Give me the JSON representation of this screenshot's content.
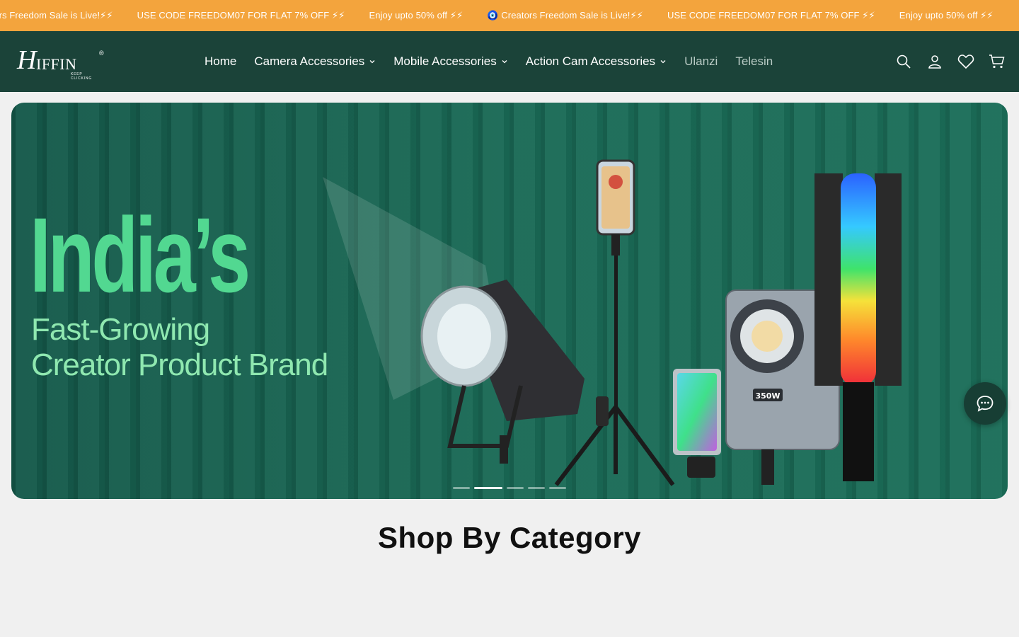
{
  "announcement": {
    "messages": [
      "Creators Freedom Sale is Live!⚡⚡",
      "USE CODE FREEDOM07 FOR FLAT 7% OFF ⚡⚡",
      "Enjoy upto 50% off ⚡⚡",
      "🧿 Creators Freedom Sale is Live!⚡⚡",
      "USE CODE FREEDOM07 FOR FLAT 7% OFF ⚡⚡",
      "Enjoy upto 50% off ⚡⚡"
    ]
  },
  "header": {
    "logo": {
      "mark": "H",
      "word": "IFFIN",
      "reg": "®",
      "tagline": "KEEP CLICKING"
    },
    "nav": [
      {
        "label": "Home",
        "dropdown": false
      },
      {
        "label": "Camera Accessories",
        "dropdown": true
      },
      {
        "label": "Mobile Accessories",
        "dropdown": true
      },
      {
        "label": "Action Cam Accessories",
        "dropdown": true
      },
      {
        "label": "Ulanzi",
        "dropdown": false
      },
      {
        "label": "Telesin",
        "dropdown": false
      }
    ],
    "icons": [
      "search-icon",
      "account-icon",
      "wishlist-heart-icon",
      "cart-icon"
    ]
  },
  "hero": {
    "headline": "India’s",
    "subline1": "Fast-Growing",
    "subline2": "Creator Product Brand",
    "light_badge": "350W",
    "slide_count": 5,
    "active_slide": 2
  },
  "section": {
    "title": "Shop By Category"
  },
  "colors": {
    "announcement_bg": "#f3a43d",
    "header_bg": "#1b4339",
    "accent_green": "#52d891"
  }
}
